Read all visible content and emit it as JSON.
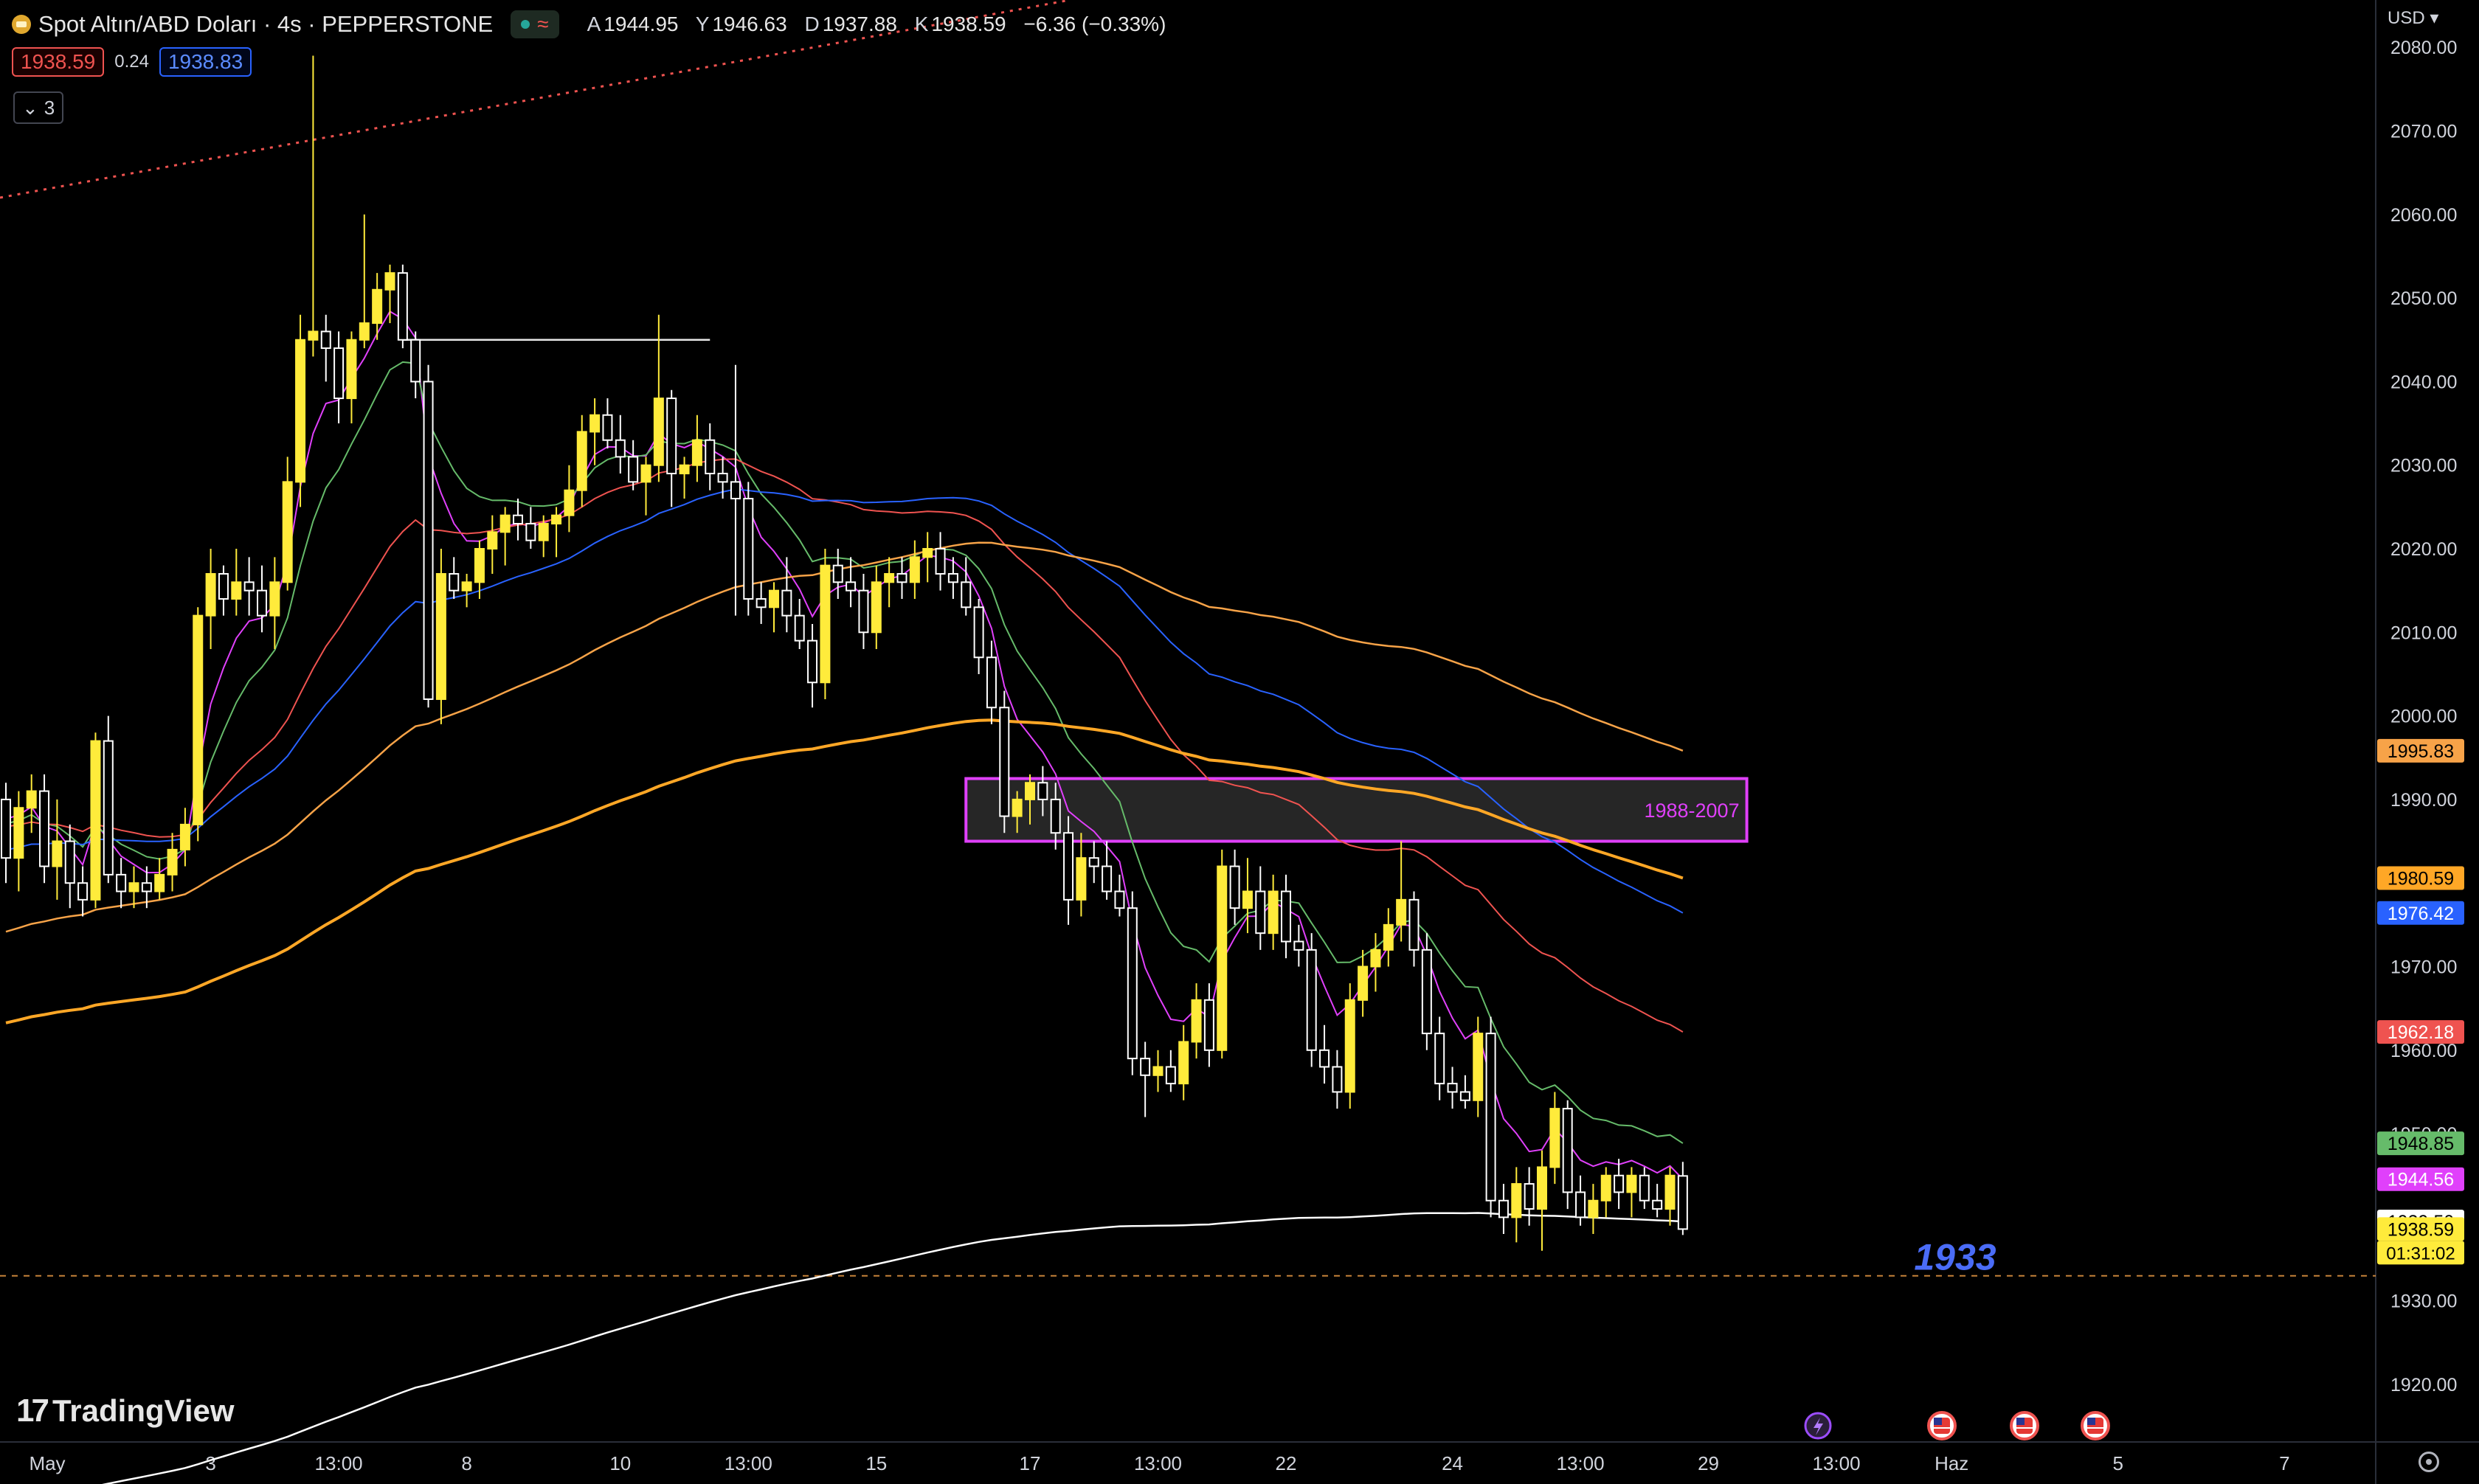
{
  "header": {
    "symbol": "Spot Altın/ABD Doları · 4s · PEPPERSTONE",
    "ohlc": [
      {
        "key": "A",
        "value": "1944.95"
      },
      {
        "key": "Y",
        "value": "1946.63"
      },
      {
        "key": "D",
        "value": "1937.88"
      },
      {
        "key": "K",
        "value": "1938.59"
      }
    ],
    "change": "−6.36 (−0.33%)",
    "bid": "1938.59",
    "spread": "0.24",
    "ask": "1938.83",
    "indicators_collapsed_count": "3"
  },
  "currency": "USD",
  "brand": "TradingView",
  "chart_data": {
    "type": "line",
    "instrument": "Spot Altın/ABD Doları",
    "timeframe": "4s",
    "ylim": [
      1915,
      2085
    ],
    "y_ticks": [
      1920,
      1930,
      1940,
      1950,
      1960,
      1970,
      1980,
      1990,
      2000,
      2010,
      2020,
      2030,
      2040,
      2050,
      2060,
      2070,
      2080
    ],
    "y_tick_labels": [
      "1920.00",
      "1930.00",
      "1950.00",
      "1960.00",
      "1970.00",
      "1990.00",
      "2000.00",
      "2010.00",
      "2020.00",
      "2030.00",
      "2040.00",
      "2050.00",
      "2060.00",
      "2070.00",
      "2080.00"
    ],
    "x_tick_labels": [
      "May",
      "3",
      "13:00",
      "8",
      "10",
      "13:00",
      "15",
      "17",
      "13:00",
      "22",
      "24",
      "13:00",
      "29",
      "13:00",
      "Haz",
      "5",
      "7"
    ],
    "x_tick_index": [
      0,
      16,
      26,
      36,
      48,
      58,
      68,
      80,
      90,
      100,
      113,
      123,
      133,
      143,
      152,
      165,
      178
    ],
    "candles": [
      [
        1990,
        1992,
        1980,
        1983
      ],
      [
        1983,
        1991,
        1979,
        1989
      ],
      [
        1989,
        1993,
        1986,
        1991
      ],
      [
        1991,
        1993,
        1980,
        1982
      ],
      [
        1982,
        1990,
        1978,
        1985
      ],
      [
        1985,
        1987,
        1977,
        1980
      ],
      [
        1980,
        1982,
        1976,
        1978
      ],
      [
        1978,
        1998,
        1977,
        1997
      ],
      [
        1997,
        2000,
        1980,
        1981
      ],
      [
        1981,
        1983,
        1977,
        1979
      ],
      [
        1979,
        1982,
        1977,
        1980
      ],
      [
        1980,
        1982,
        1977,
        1979
      ],
      [
        1979,
        1983,
        1978,
        1981
      ],
      [
        1981,
        1986,
        1979,
        1984
      ],
      [
        1984,
        1989,
        1982,
        1987
      ],
      [
        1987,
        2013,
        1985,
        2012
      ],
      [
        2012,
        2020,
        2008,
        2017
      ],
      [
        2017,
        2018,
        2012,
        2014
      ],
      [
        2014,
        2020,
        2012,
        2016
      ],
      [
        2016,
        2019,
        2012,
        2015
      ],
      [
        2015,
        2018,
        2010,
        2012
      ],
      [
        2012,
        2019,
        2008,
        2016
      ],
      [
        2016,
        2031,
        2015,
        2028
      ],
      [
        2028,
        2048,
        2025,
        2045
      ],
      [
        2045,
        2079,
        2043,
        2046
      ],
      [
        2046,
        2048,
        2040,
        2044
      ],
      [
        2044,
        2046,
        2035,
        2038
      ],
      [
        2038,
        2046,
        2035,
        2045
      ],
      [
        2045,
        2060,
        2044,
        2047
      ],
      [
        2047,
        2053,
        2045,
        2051
      ],
      [
        2051,
        2054,
        2047,
        2053
      ],
      [
        2053,
        2054,
        2044,
        2045
      ],
      [
        2045,
        2046,
        2038,
        2040
      ],
      [
        2040,
        2042,
        2001,
        2002
      ],
      [
        2002,
        2020,
        1999,
        2017
      ],
      [
        2017,
        2019,
        2014,
        2015
      ],
      [
        2015,
        2017,
        2013,
        2016
      ],
      [
        2016,
        2021,
        2014,
        2020
      ],
      [
        2020,
        2024,
        2017,
        2022
      ],
      [
        2022,
        2025,
        2018,
        2024
      ],
      [
        2024,
        2026,
        2021,
        2023
      ],
      [
        2023,
        2025,
        2020,
        2021
      ],
      [
        2021,
        2024,
        2019,
        2023
      ],
      [
        2023,
        2025,
        2019,
        2024
      ],
      [
        2024,
        2030,
        2022,
        2027
      ],
      [
        2027,
        2036,
        2025,
        2034
      ],
      [
        2034,
        2038,
        2030,
        2036
      ],
      [
        2036,
        2038,
        2032,
        2033
      ],
      [
        2033,
        2036,
        2029,
        2031
      ],
      [
        2031,
        2033,
        2027,
        2028
      ],
      [
        2028,
        2031,
        2024,
        2030
      ],
      [
        2030,
        2048,
        2028,
        2038
      ],
      [
        2038,
        2039,
        2025,
        2029
      ],
      [
        2029,
        2031,
        2026,
        2030
      ],
      [
        2030,
        2036,
        2028,
        2033
      ],
      [
        2033,
        2035,
        2027,
        2029
      ],
      [
        2029,
        2031,
        2026,
        2028
      ],
      [
        2028,
        2042,
        2012,
        2026
      ],
      [
        2026,
        2028,
        2012,
        2014
      ],
      [
        2014,
        2016,
        2011,
        2013
      ],
      [
        2013,
        2016,
        2010,
        2015
      ],
      [
        2015,
        2019,
        2010,
        2012
      ],
      [
        2012,
        2014,
        2008,
        2009
      ],
      [
        2009,
        2011,
        2001,
        2004
      ],
      [
        2004,
        2020,
        2002,
        2018
      ],
      [
        2018,
        2020,
        2014,
        2016
      ],
      [
        2016,
        2019,
        2013,
        2015
      ],
      [
        2015,
        2017,
        2008,
        2010
      ],
      [
        2010,
        2018,
        2008,
        2016
      ],
      [
        2016,
        2019,
        2013,
        2017
      ],
      [
        2017,
        2019,
        2014,
        2016
      ],
      [
        2016,
        2021,
        2014,
        2019
      ],
      [
        2019,
        2022,
        2016,
        2020
      ],
      [
        2020,
        2022,
        2015,
        2017
      ],
      [
        2017,
        2019,
        2014,
        2016
      ],
      [
        2016,
        2019,
        2012,
        2013
      ],
      [
        2013,
        2014,
        2005,
        2007
      ],
      [
        2007,
        2009,
        1999,
        2001
      ],
      [
        2001,
        2003,
        1986,
        1988
      ],
      [
        1988,
        1991,
        1986,
        1990
      ],
      [
        1990,
        1993,
        1987,
        1992
      ],
      [
        1992,
        1994,
        1988,
        1990
      ],
      [
        1990,
        1992,
        1984,
        1986
      ],
      [
        1986,
        1988,
        1975,
        1978
      ],
      [
        1978,
        1986,
        1976,
        1983
      ],
      [
        1983,
        1985,
        1980,
        1982
      ],
      [
        1982,
        1985,
        1978,
        1979
      ],
      [
        1979,
        1981,
        1976,
        1977
      ],
      [
        1977,
        1979,
        1957,
        1959
      ],
      [
        1959,
        1961,
        1952,
        1957
      ],
      [
        1957,
        1960,
        1955,
        1958
      ],
      [
        1958,
        1960,
        1955,
        1956
      ],
      [
        1956,
        1963,
        1954,
        1961
      ],
      [
        1961,
        1968,
        1959,
        1966
      ],
      [
        1966,
        1968,
        1958,
        1960
      ],
      [
        1960,
        1984,
        1959,
        1982
      ],
      [
        1982,
        1984,
        1975,
        1977
      ],
      [
        1977,
        1983,
        1974,
        1979
      ],
      [
        1979,
        1982,
        1972,
        1974
      ],
      [
        1974,
        1981,
        1972,
        1979
      ],
      [
        1979,
        1981,
        1971,
        1973
      ],
      [
        1973,
        1975,
        1970,
        1972
      ],
      [
        1972,
        1974,
        1958,
        1960
      ],
      [
        1960,
        1963,
        1956,
        1958
      ],
      [
        1958,
        1960,
        1953,
        1955
      ],
      [
        1955,
        1968,
        1953,
        1966
      ],
      [
        1966,
        1972,
        1964,
        1970
      ],
      [
        1970,
        1974,
        1967,
        1972
      ],
      [
        1972,
        1977,
        1970,
        1975
      ],
      [
        1975,
        1985,
        1973,
        1978
      ],
      [
        1978,
        1979,
        1970,
        1972
      ],
      [
        1972,
        1974,
        1960,
        1962
      ],
      [
        1962,
        1964,
        1954,
        1956
      ],
      [
        1956,
        1958,
        1953,
        1955
      ],
      [
        1955,
        1957,
        1953,
        1954
      ],
      [
        1954,
        1964,
        1952,
        1962
      ],
      [
        1962,
        1964,
        1940,
        1942
      ],
      [
        1942,
        1944,
        1938,
        1940
      ],
      [
        1940,
        1946,
        1937,
        1944
      ],
      [
        1944,
        1946,
        1939,
        1941
      ],
      [
        1941,
        1948,
        1936,
        1946
      ],
      [
        1946,
        1955,
        1944,
        1953
      ],
      [
        1953,
        1954,
        1941,
        1943
      ],
      [
        1943,
        1945,
        1939,
        1940
      ],
      [
        1940,
        1944,
        1938,
        1942
      ],
      [
        1942,
        1946,
        1940,
        1945
      ],
      [
        1945,
        1947,
        1941,
        1943
      ],
      [
        1943,
        1946,
        1940,
        1945
      ],
      [
        1945,
        1946,
        1941,
        1942
      ],
      [
        1942,
        1944,
        1940,
        1941
      ],
      [
        1941,
        1946,
        1939,
        1945
      ],
      [
        1944.95,
        1946.63,
        1937.88,
        1938.59
      ]
    ],
    "moving_averages": [
      {
        "color": "#e040fb",
        "last": 1944.56
      },
      {
        "color": "#66bb6a",
        "last": 1948.85
      },
      {
        "color": "#ef5350",
        "last": 1962.18
      },
      {
        "color": "#2962ff",
        "last": 1976.42
      },
      {
        "color": "#f7a348",
        "last": 1995.83
      },
      {
        "color": "#ffa726",
        "last": 1980.59
      },
      {
        "color": "#ffffff",
        "last": 1939.5
      }
    ],
    "price_labels": [
      {
        "value": 1995.83,
        "text": "1995.83",
        "color": "#f7a348"
      },
      {
        "value": 1980.59,
        "text": "1980.59",
        "color": "#ffa726"
      },
      {
        "value": 1976.42,
        "text": "1976.42",
        "color": "#2962ff"
      },
      {
        "value": 1962.18,
        "text": "1962.18",
        "color": "#ef5350"
      },
      {
        "value": 1948.85,
        "text": "1948.85",
        "color": "#66bb6a"
      },
      {
        "value": 1944.56,
        "text": "1944.56",
        "color": "#e040fb"
      },
      {
        "value": 1939.5,
        "text": "1939.50",
        "color": "#ffffff"
      },
      {
        "value": 1938.59,
        "text": "1938.59",
        "color": "#ffeb3b"
      }
    ],
    "countdown": "01:31:02",
    "zone": {
      "low": 1985,
      "high": 1992.5,
      "label": "1988-2007",
      "color": "#e040fb"
    },
    "support_level": {
      "value": 1933,
      "label": "1933",
      "color": "#f7a348"
    },
    "resistance_line_value": 2045,
    "colors": {
      "bull": "#ffeb3b",
      "bear": "#ffffff",
      "background": "#000000",
      "axis_text": "#d1d4dc"
    }
  }
}
